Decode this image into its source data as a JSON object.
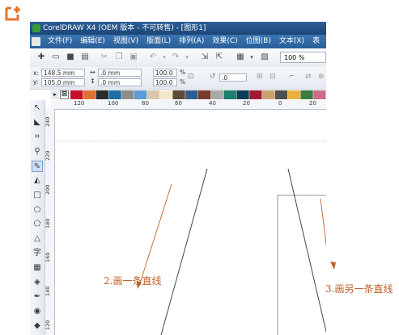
{
  "window": {
    "title": "CorelDRAW X4 (OEM 版本 - 不可转售) - [图形1]"
  },
  "menu": {
    "items": [
      {
        "label": "文件(F)"
      },
      {
        "label": "编辑(E)"
      },
      {
        "label": "视图(V)"
      },
      {
        "label": "版面(L)"
      },
      {
        "label": "排列(A)"
      },
      {
        "label": "效果(C)"
      },
      {
        "label": "位图(B)"
      },
      {
        "label": "文本(X)"
      },
      {
        "label": "表"
      }
    ]
  },
  "toolbar": {
    "zoom_value": "100 %"
  },
  "properties": {
    "x_label": "x:",
    "y_label": "y:",
    "x_value": "148.5 mm",
    "y_value": "105.0 mm",
    "width_value": ".0 mm",
    "height_value": ".0 mm",
    "scale_x": "100.0",
    "scale_y": "100.0",
    "percent_symbol": "%",
    "rotation_value": ".0"
  },
  "palette": {
    "colors": [
      "#c8102e",
      "#e0712f",
      "#2b2b2b",
      "#1d6fa5",
      "#8c8c8c",
      "#5a9bd4",
      "#d9c7a8",
      "#f3e7c9",
      "#5c4a3a",
      "#2f5e8c",
      "#7a3b2e",
      "#a9a9a9",
      "#1e7d6f",
      "#0d3d56",
      "#9e1b32",
      "#c9a46d",
      "#4f4f4f",
      "#e8b23c",
      "#3c7d3e",
      "#d06a8a"
    ]
  },
  "ruler": {
    "h_ticks": [
      "120",
      "100",
      "80",
      "60",
      "40",
      "20",
      "0",
      "20"
    ],
    "v_ticks": [
      "240",
      "220",
      "200",
      "180",
      "160",
      "140",
      "120"
    ]
  },
  "annotations": {
    "step2": "2.画一条直线",
    "step3": "3.画另一条直线",
    "color": "#c0602a"
  },
  "icons": {
    "badge": "add-badge-icon",
    "tools": [
      "pick-tool-icon",
      "shape-tool-icon",
      "crop-tool-icon",
      "zoom-tool-icon",
      "freehand-tool-icon",
      "smart-fill-icon",
      "rectangle-tool-icon",
      "ellipse-tool-icon",
      "polygon-tool-icon",
      "basic-shapes-icon",
      "text-tool-icon",
      "table-tool-icon",
      "interactive-blend-icon",
      "eyedropper-tool-icon",
      "outline-tool-icon",
      "fill-tool-icon"
    ]
  }
}
